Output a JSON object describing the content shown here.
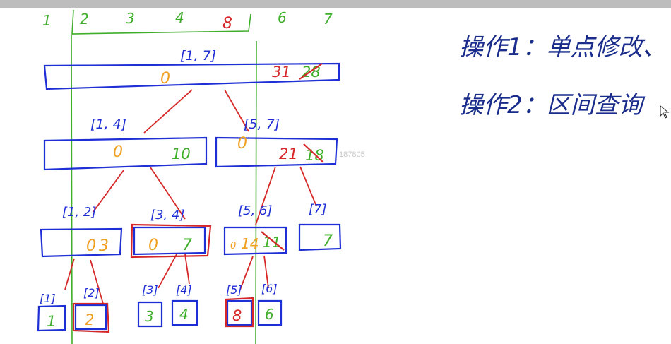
{
  "colors": {
    "blue": "#1f2fd6",
    "red": "#d62828",
    "green": "#3fae2a",
    "orange": "#f0a021",
    "dark_navy": "#1a2c8c",
    "topbar": "#bdbdbd",
    "watermark": "#c8c8c8"
  },
  "top_indices": [
    "1",
    "2",
    "3",
    "4",
    "8",
    "6",
    "7"
  ],
  "nodes": {
    "root": {
      "range": "[1, 7]",
      "lazy": "0",
      "sum": "31",
      "old_sum": "28"
    },
    "n14": {
      "range": "[1, 4]",
      "lazy": "0",
      "sum": "10"
    },
    "n57": {
      "range": "[5, 7]",
      "lazy": "0",
      "sum": "21",
      "old_sum": "18"
    },
    "n12": {
      "range": "[1, 2]",
      "lazy": "0",
      "sum": "3"
    },
    "n34": {
      "range": "[3, 4]",
      "lazy": "0",
      "sum": "7"
    },
    "n56": {
      "range": "[5, 6]",
      "lazy": "0",
      "sum": "14",
      "old_sum": "11"
    },
    "n7": {
      "range": "[7]",
      "sum": "7"
    },
    "leaf1": {
      "range": "[1]",
      "value": "1"
    },
    "leaf2": {
      "range": "[2]",
      "value": "2"
    },
    "leaf3": {
      "range": "[3]",
      "value": "3"
    },
    "leaf4": {
      "range": "[4]",
      "value": "4"
    },
    "leaf5": {
      "range": "[5]",
      "value": "8"
    },
    "leaf6": {
      "range": "[6]",
      "value": "6"
    }
  },
  "notes": {
    "op1": "操作1：单点修改、",
    "op2": "操作2：区间查询"
  },
  "watermark": "187805"
}
